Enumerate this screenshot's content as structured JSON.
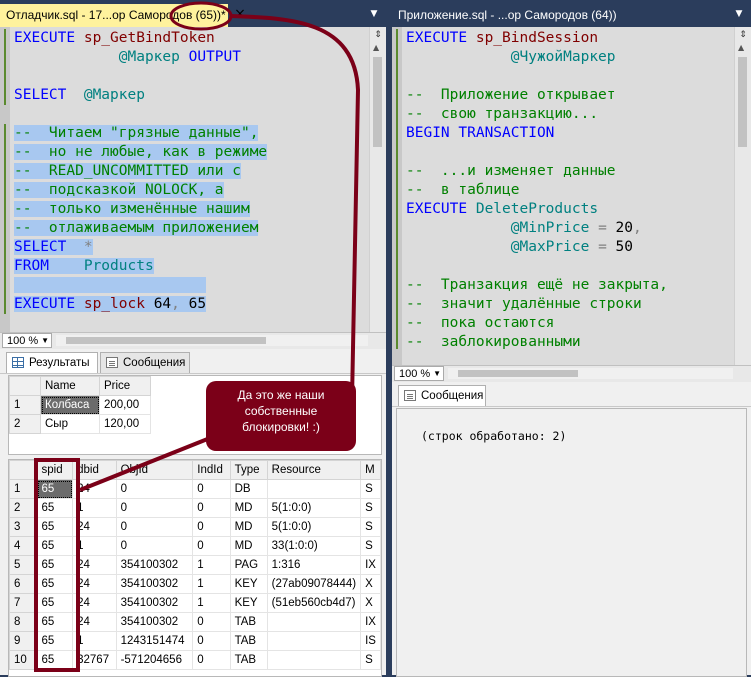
{
  "left": {
    "tab_title": "Отладчик.sql - 17...ор Самородов (65))*",
    "close_glyph": "×",
    "dropdown_glyph": "▼",
    "split_glyph": "⇕",
    "code": [
      [
        {
          "t": "EXECUTE ",
          "c": "kw"
        },
        {
          "t": "sp_GetBindToken",
          "c": "fn"
        }
      ],
      [
        {
          "t": "            @Маркер ",
          "c": "var"
        },
        {
          "t": "OUTPUT",
          "c": "kw"
        }
      ],
      [],
      [
        {
          "t": "SELECT  ",
          "c": "kw"
        },
        {
          "t": "@Маркер",
          "c": "var"
        }
      ],
      [],
      [
        {
          "t": "--  Читаем \"грязные данные\",",
          "c": "cm sel"
        }
      ],
      [
        {
          "t": "--  но не любые, как в режиме",
          "c": "cm sel"
        }
      ],
      [
        {
          "t": "--  READ_UNCOMMITTED или с",
          "c": "cm sel"
        }
      ],
      [
        {
          "t": "--  подсказкой NOLOCK, а",
          "c": "cm sel"
        }
      ],
      [
        {
          "t": "--  только изменённые нашим",
          "c": "cm sel"
        }
      ],
      [
        {
          "t": "--  отлаживаемым приложением",
          "c": "cm sel"
        }
      ],
      [
        {
          "t": "SELECT  ",
          "c": "kw sel"
        },
        {
          "t": "*",
          "c": "gray sel"
        }
      ],
      [
        {
          "t": "FROM    ",
          "c": "kw sel"
        },
        {
          "t": "Products",
          "c": "var sel"
        }
      ],
      [
        {
          "t": "                      ",
          "c": "sel"
        }
      ],
      [
        {
          "t": "EXECUTE ",
          "c": "kw sel"
        },
        {
          "t": "sp_lock ",
          "c": "fn sel"
        },
        {
          "t": "64",
          "c": "sel"
        },
        {
          "t": ", ",
          "c": "gray sel"
        },
        {
          "t": "65",
          "c": "sel"
        }
      ]
    ],
    "zoom": "100 %",
    "tabs": {
      "results": "Результаты",
      "messages": "Сообщения"
    },
    "products": {
      "columns": [
        "",
        "Name",
        "Price"
      ],
      "rows": [
        [
          "1",
          "Колбаса",
          "200,00"
        ],
        [
          "2",
          "Сыр",
          "120,00"
        ]
      ]
    },
    "locks": {
      "columns": [
        "",
        "spid",
        "dbid",
        "ObjId",
        "IndId",
        "Type",
        "Resource",
        "M"
      ],
      "rows": [
        [
          "1",
          "65",
          "24",
          "0",
          "0",
          "DB",
          "",
          "S"
        ],
        [
          "2",
          "65",
          "1",
          "0",
          "0",
          "MD",
          "5(1:0:0)",
          "S"
        ],
        [
          "3",
          "65",
          "24",
          "0",
          "0",
          "MD",
          "5(1:0:0)",
          "S"
        ],
        [
          "4",
          "65",
          "1",
          "0",
          "0",
          "MD",
          "33(1:0:0)",
          "S"
        ],
        [
          "5",
          "65",
          "24",
          "354100302",
          "1",
          "PAG",
          "1:316",
          "IX"
        ],
        [
          "6",
          "65",
          "24",
          "354100302",
          "1",
          "KEY",
          "(27ab09078444)",
          "X"
        ],
        [
          "7",
          "65",
          "24",
          "354100302",
          "1",
          "KEY",
          "(51eb560cb4d7)",
          "X"
        ],
        [
          "8",
          "65",
          "24",
          "354100302",
          "0",
          "TAB",
          "",
          "IX"
        ],
        [
          "9",
          "65",
          "1",
          "1243151474",
          "0",
          "TAB",
          "",
          "IS"
        ],
        [
          "10",
          "65",
          "32767",
          "-571204656",
          "0",
          "TAB",
          "",
          "S"
        ]
      ]
    }
  },
  "right": {
    "tab_title": "Приложение.sql - ...ор Самородов (64))",
    "dropdown_glyph": "▼",
    "split_glyph": "⇕",
    "code": [
      [
        {
          "t": "EXECUTE ",
          "c": "kw"
        },
        {
          "t": "sp_BindSession",
          "c": "fn"
        }
      ],
      [
        {
          "t": "            @ЧужойМаркер",
          "c": "var"
        }
      ],
      [],
      [
        {
          "t": "--  Приложение открывает",
          "c": "cm"
        }
      ],
      [
        {
          "t": "--  свою транзакцию...",
          "c": "cm"
        }
      ],
      [
        {
          "t": "BEGIN TRANSACTION",
          "c": "kw"
        }
      ],
      [],
      [
        {
          "t": "--  ...и изменяет данные",
          "c": "cm"
        }
      ],
      [
        {
          "t": "--  в таблице",
          "c": "cm"
        }
      ],
      [
        {
          "t": "EXECUTE ",
          "c": "kw"
        },
        {
          "t": "DeleteProducts",
          "c": "var"
        }
      ],
      [
        {
          "t": "            @MinPrice ",
          "c": "var"
        },
        {
          "t": "= ",
          "c": "gray"
        },
        {
          "t": "20",
          "c": ""
        },
        {
          "t": ",",
          "c": "gray"
        }
      ],
      [
        {
          "t": "            @MaxPrice ",
          "c": "var"
        },
        {
          "t": "= ",
          "c": "gray"
        },
        {
          "t": "50",
          "c": ""
        }
      ],
      [],
      [
        {
          "t": "--  Транзакция ещё не закрыта,",
          "c": "cm"
        }
      ],
      [
        {
          "t": "--  значит удалённые строки",
          "c": "cm"
        }
      ],
      [
        {
          "t": "--  пока остаются",
          "c": "cm"
        }
      ],
      [
        {
          "t": "--  заблокированными",
          "c": "cm"
        }
      ]
    ],
    "zoom": "100 %",
    "tabs": {
      "messages": "Сообщения"
    },
    "message": "(строк обработано: 2)"
  },
  "callout": {
    "lines": [
      "Да это же наши",
      "собственные",
      "блокировки! :)"
    ]
  },
  "colors": {
    "annotation": "#7b0018",
    "tab_active": "#fff29d",
    "frame": "#2b3d5c"
  }
}
